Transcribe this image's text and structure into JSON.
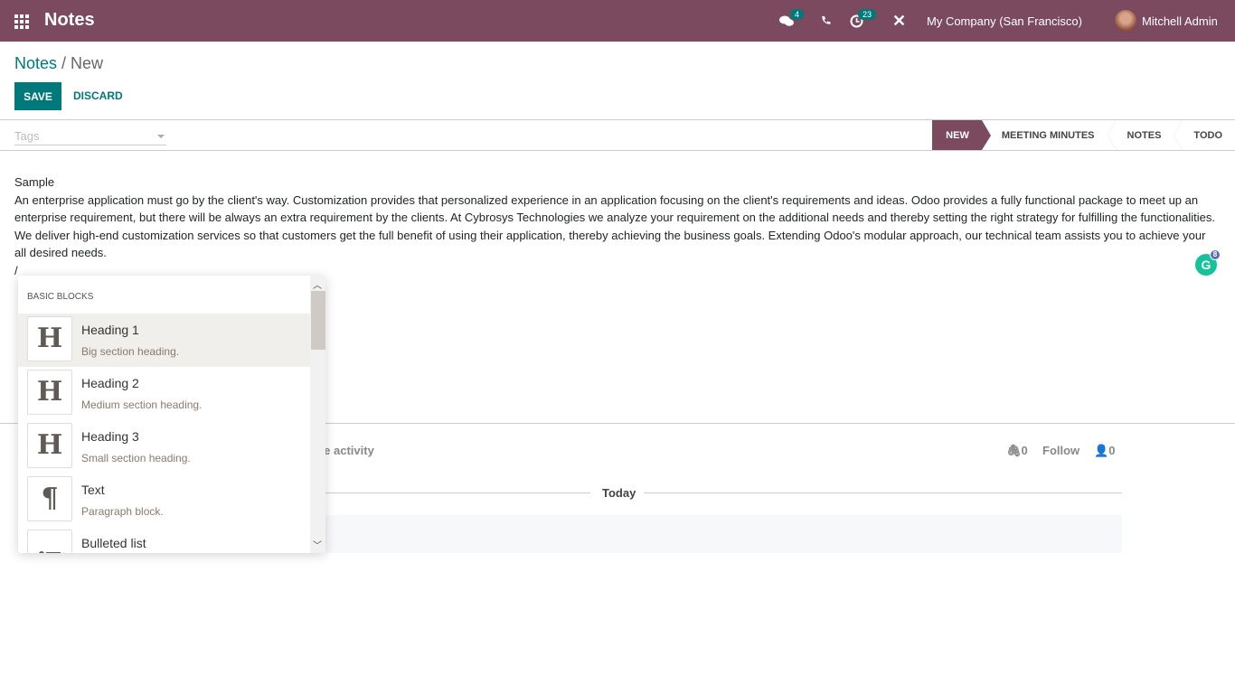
{
  "topbar": {
    "app_title": "Notes",
    "messages_count": "4",
    "activities_count": "23",
    "company": "My Company (San Francisco)",
    "user": "Mitchell Admin",
    "accent": "#7c4a5f"
  },
  "breadcrumb": {
    "parent": "Notes",
    "current": "/ New"
  },
  "buttons": {
    "save": "SAVE",
    "discard": "DISCARD"
  },
  "tags": {
    "placeholder": "Tags"
  },
  "stages": [
    {
      "label": "NEW",
      "active": true
    },
    {
      "label": "MEETING MINUTES"
    },
    {
      "label": "NOTES"
    },
    {
      "label": "TODO"
    }
  ],
  "note": {
    "lines": [
      "Sample",
      "An enterprise application must go by the client's way. Customization provides that personalized experience in an application focusing on the client's requirements and ideas. Odoo provides a fully functional package to meet up an",
      "enterprise requirement, but there will be always an extra requirement by the clients. At Cybrosys Technologies we analyze your requirement on the additional needs and thereby setting the right strategy for fulfilling the functionalities.",
      "We deliver high-end customization services so that customers get the full benefit of using their application, thereby achieving the business goals. Extending Odoo's modular approach, our technical team assists you to achieve your",
      "all desired needs.",
      "/"
    ]
  },
  "grammarly": {
    "count": "8",
    "letter": "G"
  },
  "chatter": {
    "schedule_activity_partial": "lule activity",
    "attachments": "0",
    "follow": "Follow",
    "followers": "0",
    "today": "Today"
  },
  "dropdown": {
    "header": "BASIC BLOCKS",
    "items": [
      {
        "icon": "H",
        "title": "Heading 1",
        "desc": "Big section heading."
      },
      {
        "icon": "H",
        "title": "Heading 2",
        "desc": "Medium section heading."
      },
      {
        "icon": "H",
        "title": "Heading 3",
        "desc": "Small section heading."
      },
      {
        "icon": "¶",
        "title": "Text",
        "desc": "Paragraph block."
      },
      {
        "icon": "",
        "title": "Bulleted list",
        "desc": ""
      }
    ]
  }
}
